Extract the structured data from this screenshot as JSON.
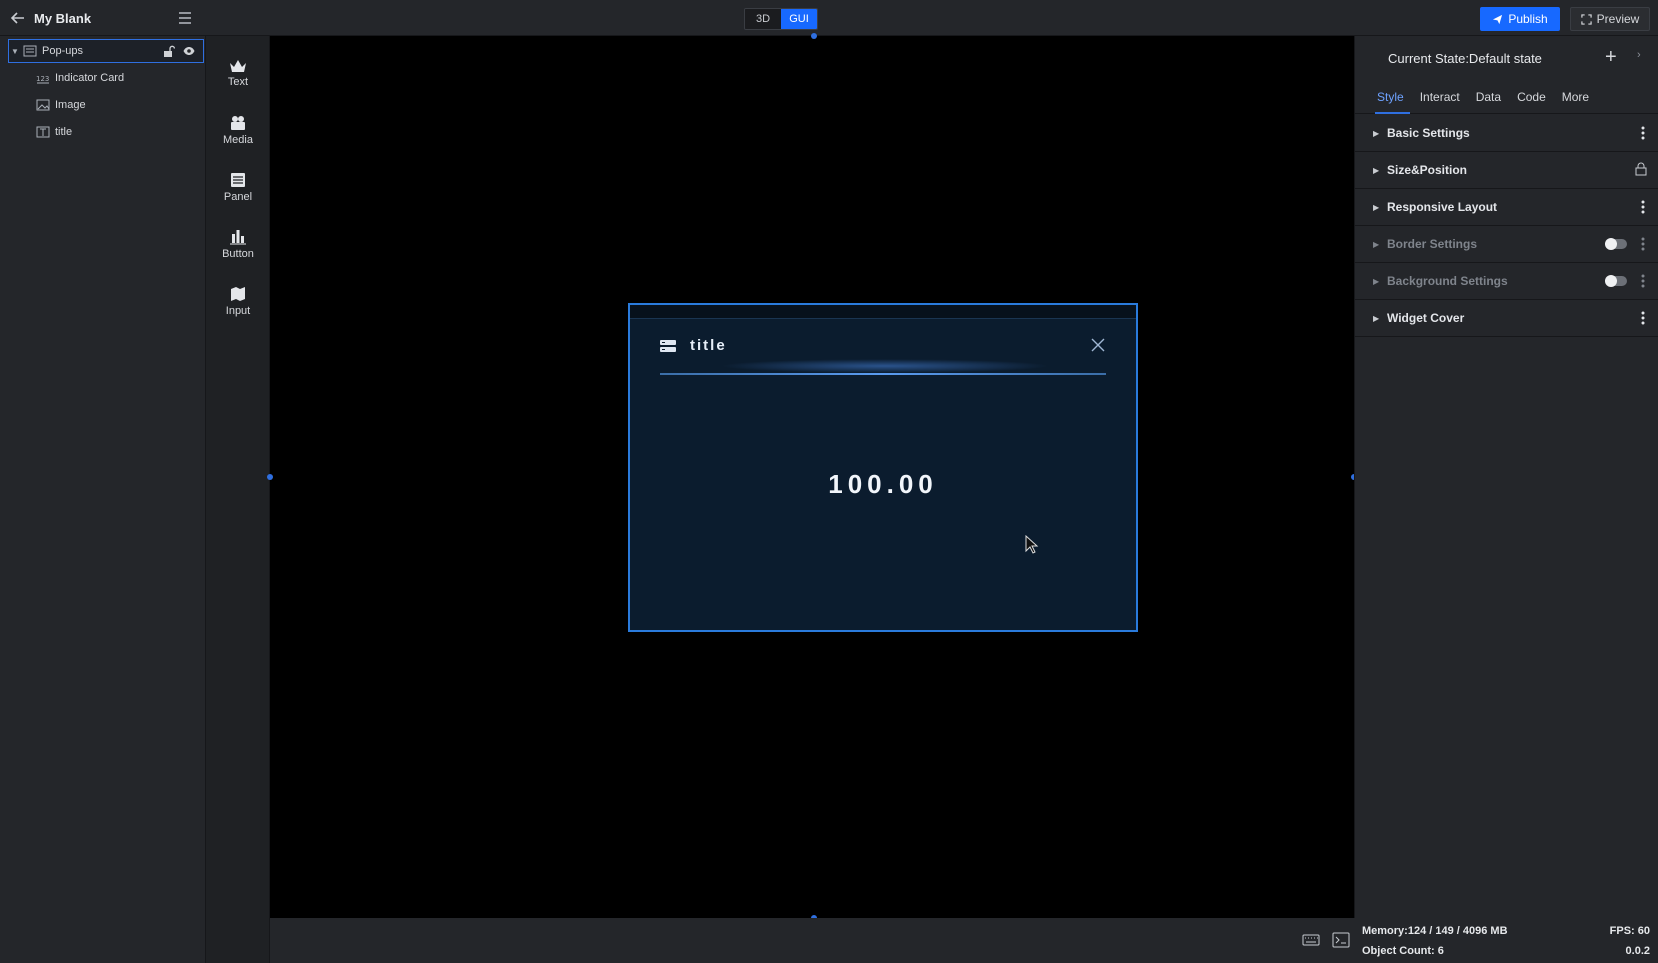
{
  "header": {
    "title": "My Blank",
    "mode_3d": "3D",
    "mode_gui": "GUI",
    "publish_label": "Publish",
    "preview_label": "Preview"
  },
  "layers": {
    "root": "Pop-ups",
    "children": [
      "Indicator Card",
      "Image",
      "title"
    ]
  },
  "widgets": [
    {
      "label": "Text",
      "icon": "text-widget-icon"
    },
    {
      "label": "Media",
      "icon": "media-widget-icon"
    },
    {
      "label": "Panel",
      "icon": "panel-widget-icon"
    },
    {
      "label": "Button",
      "icon": "button-widget-icon"
    },
    {
      "label": "Input",
      "icon": "input-widget-icon"
    }
  ],
  "popup": {
    "title": "title",
    "value": "100.00"
  },
  "properties": {
    "state_label": "Current State:Default state",
    "tabs": [
      "Style",
      "Interact",
      "Data",
      "Code",
      "More"
    ],
    "active_tab": "Style",
    "sections": [
      {
        "label": "Basic Settings",
        "control": "kebab"
      },
      {
        "label": "Size&Position",
        "control": "lock"
      },
      {
        "label": "Responsive Layout",
        "control": "kebab"
      },
      {
        "label": "Border Settings",
        "control": "toggle"
      },
      {
        "label": "Background Settings",
        "control": "toggle"
      },
      {
        "label": "Widget Cover",
        "control": "kebab"
      }
    ]
  },
  "status": {
    "memory": "Memory:124 / 149 / 4096 MB",
    "object_count": "Object Count: 6",
    "fps": "FPS: 60",
    "version": "0.0.2"
  },
  "colors": {
    "accent": "#1769ff",
    "popup_border": "#2a7bdc",
    "popup_bg": "#0b1c2e"
  }
}
